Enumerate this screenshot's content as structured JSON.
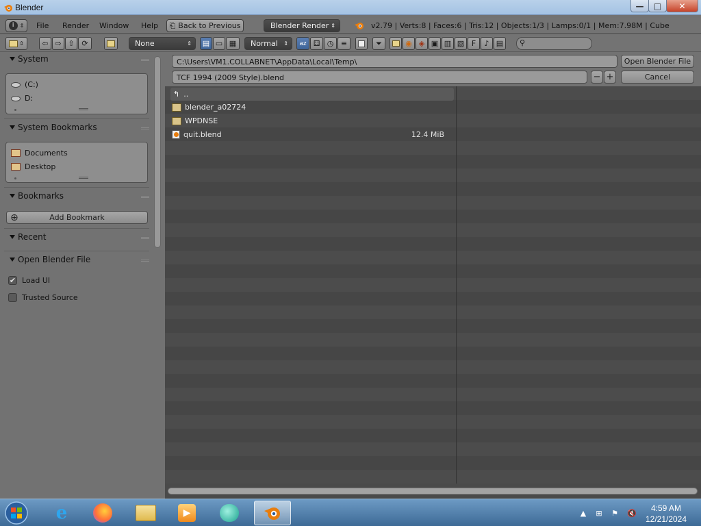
{
  "window": {
    "title": "Blender",
    "minimize": "—",
    "maximize": "□",
    "close": "✕"
  },
  "infobar": {
    "menus": [
      "File",
      "Render",
      "Window",
      "Help"
    ],
    "back_button": "Back to Previous",
    "render_engine": "Blender Render",
    "stats": "v2.79 | Verts:8 | Faces:6 | Tris:12 | Objects:1/3 | Lamps:0/1 | Mem:7.98M | Cube"
  },
  "toolbar": {
    "recent_dropdown": "None",
    "display_size": "Normal",
    "search_placeholder": ""
  },
  "sidebar": {
    "system": {
      "title": "System",
      "items": [
        "(C:)",
        "D:"
      ]
    },
    "system_bookmarks": {
      "title": "System Bookmarks",
      "items": [
        "Documents",
        "Desktop"
      ]
    },
    "bookmarks": {
      "title": "Bookmarks",
      "add_button": "Add Bookmark"
    },
    "recent": {
      "title": "Recent"
    },
    "open_options": {
      "title": "Open Blender File",
      "load_ui": {
        "label": "Load UI",
        "checked": true
      },
      "trusted_source": {
        "label": "Trusted Source",
        "checked": false
      }
    }
  },
  "path": {
    "directory": "C:\\Users\\VM1.COLLABNET\\AppData\\Local\\Temp\\",
    "filename": "TCF 1994 (2009 Style).blend",
    "open_button": "Open Blender File",
    "cancel_button": "Cancel"
  },
  "files": [
    {
      "name": "..",
      "type": "parent",
      "size": ""
    },
    {
      "name": "blender_a02724",
      "type": "folder",
      "size": ""
    },
    {
      "name": "WPDNSE",
      "type": "folder",
      "size": ""
    },
    {
      "name": "quit.blend",
      "type": "blend",
      "size": "12.4 MiB"
    }
  ],
  "taskbar": {
    "apps": [
      "start-orb",
      "internet-explorer",
      "firefox",
      "file-explorer",
      "media-player",
      "messenger",
      "blender"
    ],
    "active_app": "blender",
    "time": "4:59 AM",
    "date": "12/21/2024"
  },
  "colors": {
    "panel_bg": "#727272",
    "list_bg": "#4c4c4c",
    "titlebar": "#b9d1ea",
    "taskbar": "#4f7ba6",
    "close_btn": "#c7442a"
  }
}
